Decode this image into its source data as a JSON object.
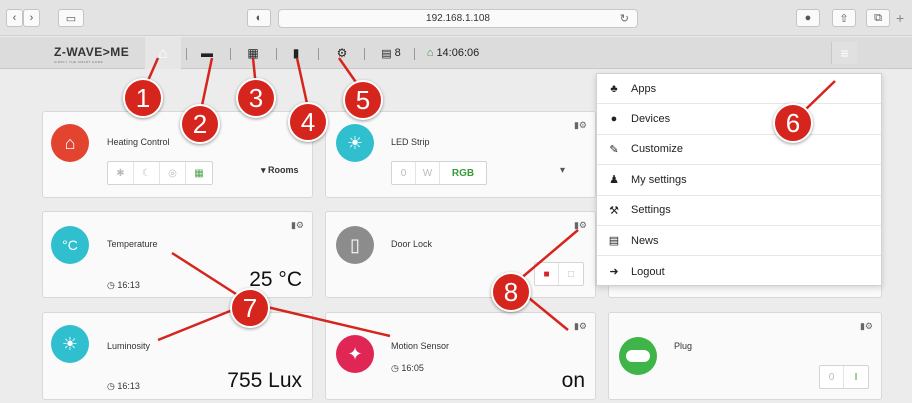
{
  "browser": {
    "url": "192.168.1.108",
    "back_icon": "chevron-left",
    "forward_icon": "chevron-right"
  },
  "appbar": {
    "logo": "Z-WAVE>ME",
    "logo_tagline": "SIMPLY THE SMART HOME",
    "devices_count": "8",
    "clock": "14:06:06"
  },
  "widgets": {
    "heating": {
      "title": "Heating Control",
      "rooms_label": "Rooms"
    },
    "led": {
      "title": "LED Strip",
      "buttons": [
        "0",
        "W",
        "RGB"
      ]
    },
    "temperature": {
      "title": "Temperature",
      "time": "16:13",
      "value": "25 °C"
    },
    "door": {
      "title": "Door Lock"
    },
    "luminosity": {
      "title": "Luminosity",
      "time": "16:13",
      "value": "755 Lux"
    },
    "motion": {
      "title": "Motion Sensor",
      "time": "16:05",
      "value": "on"
    },
    "plug": {
      "title": "Plug",
      "buttons": [
        "0",
        "I"
      ]
    }
  },
  "menu": {
    "items": [
      "Apps",
      "Devices",
      "Customize",
      "My settings",
      "Settings",
      "News",
      "Logout"
    ]
  },
  "callouts": [
    "1",
    "2",
    "3",
    "4",
    "5",
    "6",
    "7",
    "8"
  ],
  "colors": {
    "heating_icon": "#e2442f",
    "led_icon": "#30bfcf",
    "temperature_icon": "#30bfcf",
    "door_icon": "#8c8c8c",
    "luminosity_icon": "#30bfcf",
    "motion_icon": "#e02655",
    "plug_icon": "#3fb549",
    "callout": "#d6251c"
  }
}
